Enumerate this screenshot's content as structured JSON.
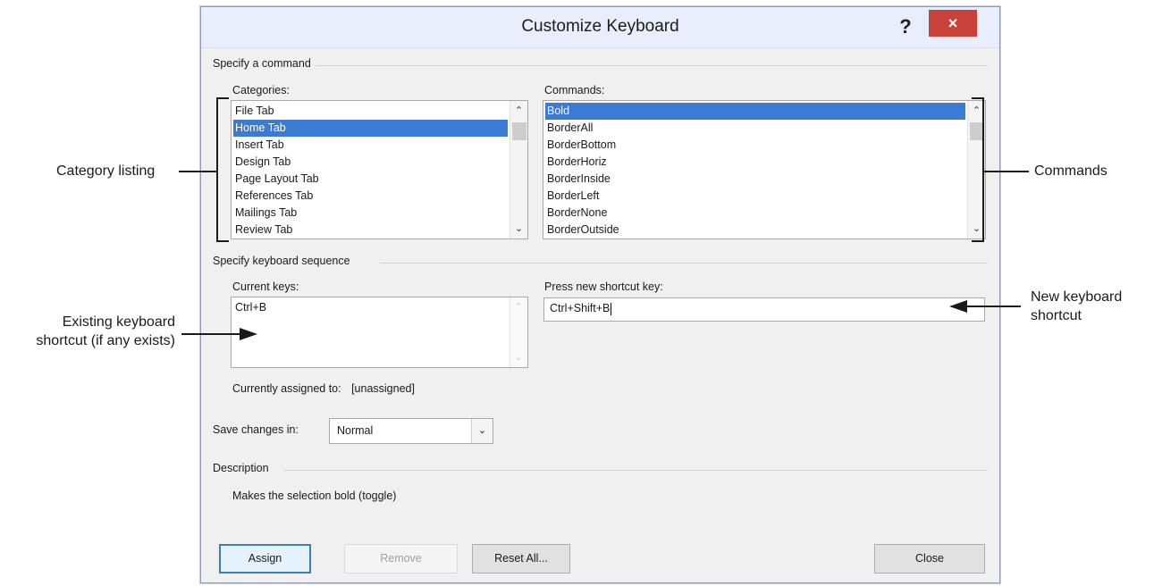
{
  "dialog": {
    "title": "Customize Keyboard",
    "help_label": "?",
    "close_label": "×"
  },
  "specify_command": {
    "group_label": "Specify a command",
    "categories_label": "Categories:",
    "categories": [
      "File Tab",
      "Home Tab",
      "Insert Tab",
      "Design Tab",
      "Page Layout Tab",
      "References Tab",
      "Mailings Tab",
      "Review Tab"
    ],
    "categories_selected": "Home Tab",
    "commands_label": "Commands:",
    "commands": [
      "Bold",
      "BorderAll",
      "BorderBottom",
      "BorderHoriz",
      "BorderInside",
      "BorderLeft",
      "BorderNone",
      "BorderOutside"
    ],
    "commands_selected": "Bold"
  },
  "keyboard_sequence": {
    "group_label": "Specify keyboard sequence",
    "current_keys_label": "Current keys:",
    "current_keys": [
      "Ctrl+B"
    ],
    "new_shortcut_label": "Press new shortcut key:",
    "new_shortcut_value": "Ctrl+Shift+B",
    "currently_assigned_label": "Currently assigned to:",
    "currently_assigned_value": "[unassigned]"
  },
  "save_changes": {
    "label": "Save changes in:",
    "value": "Normal"
  },
  "description": {
    "group_label": "Description",
    "text": "Makes the selection bold (toggle)"
  },
  "buttons": {
    "assign": "Assign",
    "remove": "Remove",
    "reset_all": "Reset All...",
    "close": "Close"
  },
  "callouts": {
    "category_listing": "Category listing",
    "commands": "Commands",
    "new_shortcut_line1": "New keyboard",
    "new_shortcut_line2": "shortcut",
    "existing_line1": "Existing keyboard",
    "existing_line2": "shortcut (if any exists)"
  },
  "colors": {
    "selection": "#3b7bd4",
    "close_button": "#c9423a",
    "titlebar": "#e8eefc"
  }
}
